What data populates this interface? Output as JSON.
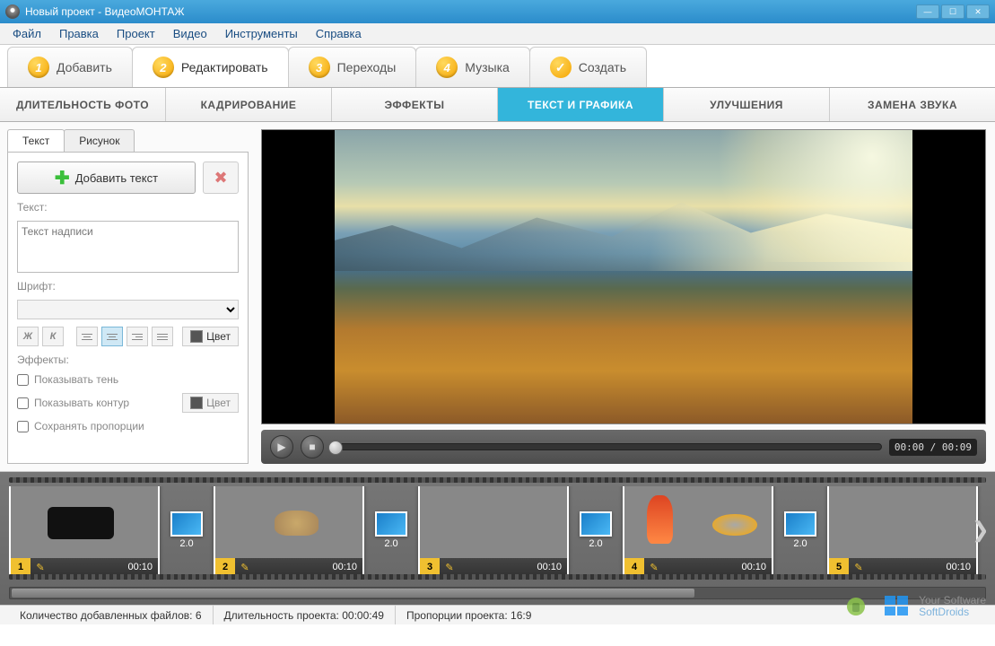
{
  "window": {
    "title": "Новый проект - ВидеоМОНТАЖ"
  },
  "menu": {
    "file": "Файл",
    "edit": "Правка",
    "project": "Проект",
    "video": "Видео",
    "tools": "Инструменты",
    "help": "Справка"
  },
  "wizard": {
    "add": "Добавить",
    "editBtn": "Редактировать",
    "transitions": "Переходы",
    "music": "Музыка",
    "create": "Создать"
  },
  "subtabs": {
    "duration": "ДЛИТЕЛЬНОСТЬ ФОТО",
    "crop": "КАДРИРОВАНИЕ",
    "effects": "ЭФФЕКТЫ",
    "text": "ТЕКСТ И ГРАФИКА",
    "enhance": "УЛУЧШЕНИЯ",
    "audio": "ЗАМЕНА ЗВУКА"
  },
  "leftpanel": {
    "tabText": "Текст",
    "tabImage": "Рисунок",
    "addText": "Добавить текст",
    "textLabel": "Текст:",
    "textValue": "Текст надписи",
    "fontLabel": "Шрифт:",
    "bold": "Ж",
    "italic": "К",
    "color": "Цвет",
    "effectsLabel": "Эффекты:",
    "shadow": "Показывать тень",
    "outline": "Показывать контур",
    "outlineColor": "Цвет",
    "keepRatio": "Сохранять пропорции"
  },
  "player": {
    "time": "00:00 / 00:09"
  },
  "clips": [
    {
      "n": "1",
      "dur": "00:10"
    },
    {
      "n": "2",
      "dur": "00:10"
    },
    {
      "n": "3",
      "dur": "00:10"
    },
    {
      "n": "4",
      "dur": "00:10"
    },
    {
      "n": "5",
      "dur": "00:10"
    }
  ],
  "transDur": "2.0",
  "status": {
    "filesLabel": "Количество добавленных файлов:",
    "filesVal": "6",
    "lenLabel": "Длительность проекта:",
    "lenVal": "00:00:49",
    "aspectLabel": "Пропорции проекта:",
    "aspectVal": "16:9"
  },
  "watermark": {
    "line1": "Your Software",
    "line2": "SoftDroids"
  }
}
